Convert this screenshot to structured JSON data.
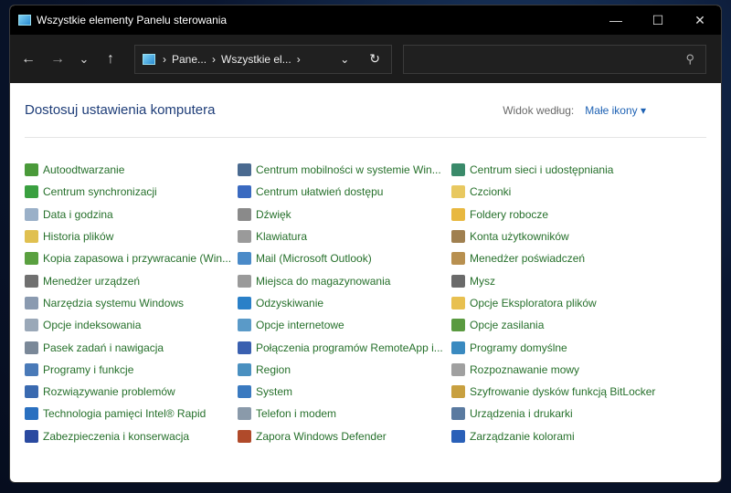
{
  "window": {
    "title": "Wszystkie elementy Panelu sterowania",
    "minimize": "—",
    "maximize": "☐",
    "close": "✕"
  },
  "nav": {
    "back": "←",
    "forward": "→",
    "recent": "⌄",
    "up": "↑"
  },
  "address": {
    "segments": [
      "Pane...",
      "Wszystkie el..."
    ],
    "sep": "›",
    "dropdown": "⌄",
    "refresh": "↻"
  },
  "search": {
    "placeholder": "",
    "icon": "⚲"
  },
  "header": {
    "title": "Dostosuj ustawienia komputera",
    "view_label": "Widok według:",
    "view_value": "Małe ikony ▾"
  },
  "items": [
    {
      "label": "Autoodtwarzanie",
      "icon": "autoplay-icon",
      "color": "#4a9a3a"
    },
    {
      "label": "Centrum synchronizacji",
      "icon": "sync-icon",
      "color": "#3aa040"
    },
    {
      "label": "Data i godzina",
      "icon": "clock-icon",
      "color": "#9ab0c8"
    },
    {
      "label": "Historia plików",
      "icon": "file-history-icon",
      "color": "#e0c050"
    },
    {
      "label": "Kopia zapasowa i przywracanie (Win...",
      "icon": "backup-icon",
      "color": "#5aa040"
    },
    {
      "label": "Menedżer urządzeń",
      "icon": "device-manager-icon",
      "color": "#707070"
    },
    {
      "label": "Narzędzia systemu Windows",
      "icon": "tools-icon",
      "color": "#8a9ab0"
    },
    {
      "label": "Opcje indeksowania",
      "icon": "indexing-icon",
      "color": "#9aa8b8"
    },
    {
      "label": "Pasek zadań i nawigacja",
      "icon": "taskbar-icon",
      "color": "#7a8898"
    },
    {
      "label": "Programy i funkcje",
      "icon": "programs-icon",
      "color": "#4a7ab8"
    },
    {
      "label": "Rozwiązywanie problemów",
      "icon": "troubleshoot-icon",
      "color": "#3a6ab0"
    },
    {
      "label": "Technologia pamięci Intel® Rapid",
      "icon": "intel-rapid-icon",
      "color": "#2a70c0"
    },
    {
      "label": "Zabezpieczenia i konserwacja",
      "icon": "flag-icon",
      "color": "#2a4aa0"
    },
    {
      "label": "Centrum mobilności w systemie Win...",
      "icon": "mobility-icon",
      "color": "#4a6a90"
    },
    {
      "label": "Centrum ułatwień dostępu",
      "icon": "accessibility-icon",
      "color": "#3a6ac0"
    },
    {
      "label": "Dźwięk",
      "icon": "speaker-icon",
      "color": "#8a8a8a"
    },
    {
      "label": "Klawiatura",
      "icon": "keyboard-icon",
      "color": "#9a9a9a"
    },
    {
      "label": "Mail (Microsoft Outlook)",
      "icon": "mail-icon",
      "color": "#4a8ac8"
    },
    {
      "label": "Miejsca do magazynowania",
      "icon": "storage-icon",
      "color": "#9a9a9a"
    },
    {
      "label": "Odzyskiwanie",
      "icon": "recovery-icon",
      "color": "#2a80c8"
    },
    {
      "label": "Opcje internetowe",
      "icon": "internet-options-icon",
      "color": "#5a9ac8"
    },
    {
      "label": "Połączenia programów RemoteApp i...",
      "icon": "remoteapp-icon",
      "color": "#3a60b0"
    },
    {
      "label": "Region",
      "icon": "globe-icon",
      "color": "#4a90c0"
    },
    {
      "label": "System",
      "icon": "system-icon",
      "color": "#3a7ac0"
    },
    {
      "label": "Telefon i modem",
      "icon": "phone-modem-icon",
      "color": "#8a9aaa"
    },
    {
      "label": "Zapora Windows Defender",
      "icon": "firewall-icon",
      "color": "#b04a2a"
    },
    {
      "label": "Centrum sieci i udostępniania",
      "icon": "network-icon",
      "color": "#3a8a6a"
    },
    {
      "label": "Czcionki",
      "icon": "fonts-icon",
      "color": "#e8c860"
    },
    {
      "label": "Foldery robocze",
      "icon": "work-folders-icon",
      "color": "#e8b840"
    },
    {
      "label": "Konta użytkowników",
      "icon": "users-icon",
      "color": "#a08050"
    },
    {
      "label": "Menedżer poświadczeń",
      "icon": "credential-icon",
      "color": "#b89050"
    },
    {
      "label": "Mysz",
      "icon": "mouse-icon",
      "color": "#6a6a6a"
    },
    {
      "label": "Opcje Eksploratora plików",
      "icon": "folder-options-icon",
      "color": "#e8c050"
    },
    {
      "label": "Opcje zasilania",
      "icon": "power-icon",
      "color": "#5a9a40"
    },
    {
      "label": "Programy domyślne",
      "icon": "default-programs-icon",
      "color": "#3a8ac0"
    },
    {
      "label": "Rozpoznawanie mowy",
      "icon": "microphone-icon",
      "color": "#a0a0a0"
    },
    {
      "label": "Szyfrowanie dysków funkcją BitLocker",
      "icon": "bitlocker-icon",
      "color": "#c8a040"
    },
    {
      "label": "Urządzenia i drukarki",
      "icon": "printer-icon",
      "color": "#5a7aa0"
    },
    {
      "label": "Zarządzanie kolorami",
      "icon": "color-management-icon",
      "color": "#2a60b8"
    }
  ]
}
